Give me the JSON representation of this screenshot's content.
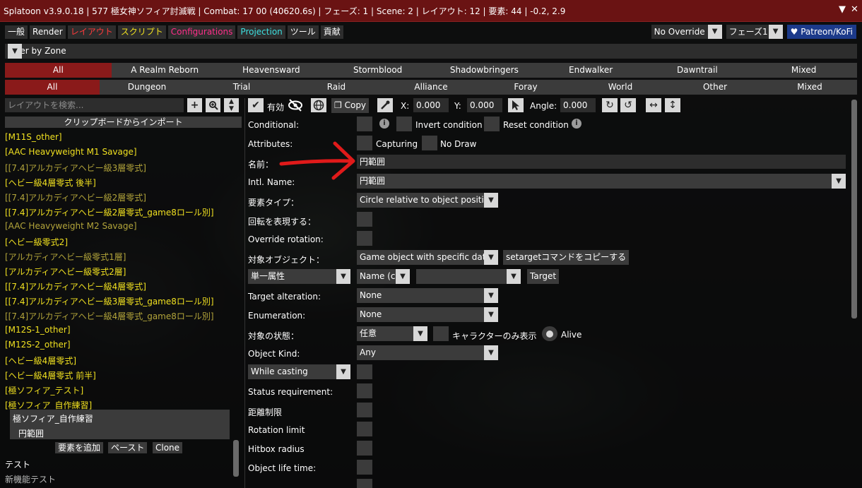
{
  "titlebar": {
    "title": "Splatoon v3.9.0.18 | 577 極女神ソフィア討滅戦 | Combat: 17 00 (40620.6s) | フェーズ: 1 | Scene: 2 | レイアウト: 12 | 要素: 44 | -0.2, 2.9",
    "collapse": "▼",
    "close": "✕"
  },
  "tabs": [
    "一般",
    "Render",
    "レイアウト",
    "スクリプト",
    "Configurations",
    "Projection",
    "ツール",
    "貢献"
  ],
  "top_right": {
    "override": "No Override",
    "phase": "フェーズ1",
    "patreon": "♥ Patreon/KoFi"
  },
  "filter": {
    "label": "Filter by Zone"
  },
  "expansions": [
    "All",
    "A Realm Reborn",
    "Heavensward",
    "Stormblood",
    "Shadowbringers",
    "Endwalker",
    "Dawntrail",
    "Mixed"
  ],
  "categories": [
    "All",
    "Dungeon",
    "Trial",
    "Raid",
    "Alliance",
    "Foray",
    "World",
    "Other",
    "Mixed"
  ],
  "left": {
    "search_placeholder": "レイアウトを検索...",
    "import_label": "クリップボードからインポート",
    "layouts": [
      {
        "label": "[M11S_other]",
        "enabled": true
      },
      {
        "label": "[AAC Heavyweight M1 Savage]",
        "enabled": true
      },
      {
        "label": "[[7.4]アルカディアヘビー級3層零式]",
        "enabled": false
      },
      {
        "label": "[ヘビー級4層零式 後半]",
        "enabled": true
      },
      {
        "label": "[[7.4]アルカディアヘビー級2層零式]",
        "enabled": false
      },
      {
        "label": "[[7.4]アルカディアヘビー級2層零式_game8ロール別]",
        "enabled": true
      },
      {
        "label": "[AAC Heavyweight M2 Savage]",
        "enabled": false
      },
      {
        "label": "[ヘビー級零式2]",
        "enabled": true
      },
      {
        "label": "[アルカディアヘビー級零式1層]",
        "enabled": false
      },
      {
        "label": "[アルカディアヘビー級零式2層]",
        "enabled": true
      },
      {
        "label": "[[7.4]アルカディアヘビー級4層零式]",
        "enabled": true
      },
      {
        "label": "[[7.4]アルカディアヘビー級3層零式_game8ロール別]",
        "enabled": true
      },
      {
        "label": "[[7.4]アルカディアヘビー級4層零式_game8ロール別]",
        "enabled": false
      },
      {
        "label": "[M12S-1_other]",
        "enabled": true
      },
      {
        "label": "[M12S-2_other]",
        "enabled": true
      },
      {
        "label": "[ヘビー級4層零式]",
        "enabled": true
      },
      {
        "label": "[ヘビー級4層零式 前半]",
        "enabled": true
      },
      {
        "label": "[極ソフィア_テスト]",
        "enabled": true
      },
      {
        "label": "[極ソフィア_自作練習]",
        "enabled": true
      }
    ],
    "selected_layout": "極ソフィア_自作練習",
    "selected_element": "円範囲",
    "add_element": "要素を追加",
    "paste": "ペースト",
    "clone": "Clone",
    "group_test": "テスト",
    "group_new": "新機能テスト"
  },
  "toolbar": {
    "enabled_label": "有効",
    "copy": "Copy",
    "x_label": "X:",
    "x": "0.000",
    "y_label": "Y:",
    "y": "0.000",
    "angle_label": "Angle:",
    "angle": "0.000"
  },
  "form": {
    "conditional": "Conditional:",
    "invert_condition": "Invert condition",
    "reset_condition": "Reset condition",
    "attributes": "Attributes:",
    "capturing": "Capturing",
    "no_draw": "No Draw",
    "name_label": "名前：",
    "name_value": "円範囲",
    "intl_name_label": "Intl. Name:",
    "intl_name_value": "円範囲",
    "element_type_label": "要素タイプ：",
    "element_type_value": "Circle relative to object positio",
    "represent_rotation": "回転を表現する：",
    "override_rotation": "Override rotation:",
    "target_object_label": "対象オブジェクト：",
    "target_object_value": "Game object with specific data",
    "copy_settarget": "setargetコマンドをコピーする",
    "single_attribute": "単一属性",
    "name_c": "Name (c",
    "attr_value": "",
    "target_btn": "Target",
    "target_alteration_label": "Target alteration:",
    "target_alteration_value": "None",
    "enumeration_label": "Enumeration:",
    "enumeration_value": "None",
    "target_state_label": "対象の状態：",
    "target_state_value": "任意",
    "characters_only": "キャラクターのみ表示",
    "alive": "Alive",
    "object_kind_label": "Object Kind:",
    "object_kind_value": "Any",
    "while_casting": "While casting",
    "status_requirement": "Status requirement:",
    "distance_limit": "距離制限",
    "rotation_limit": "Rotation limit",
    "hitbox_radius": "Hitbox radius",
    "object_life_time": "Object life time:"
  },
  "colors": {
    "titlebar": "#6a1313",
    "selected_tab": "#8a1a1a",
    "layout_yellow": "#f0e020",
    "layout_dim": "#b2a43a",
    "annotation_arrow": "#e01a1a"
  }
}
